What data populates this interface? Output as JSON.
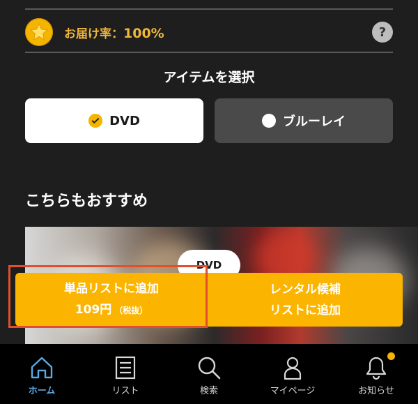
{
  "delivery": {
    "label": "お届け率：",
    "rate": "100%",
    "help_icon": "?",
    "badge_icon": "star-icon"
  },
  "item_select": {
    "title": "アイテムを選択",
    "options": [
      {
        "label": "DVD",
        "selected": true
      },
      {
        "label": "ブルーレイ",
        "selected": false
      }
    ]
  },
  "recommend": {
    "title": "こちらもおすすめ",
    "badge": "DVD"
  },
  "actions": {
    "single": {
      "line1": "単品リストに追加",
      "price": "109円",
      "tax": "（税抜）"
    },
    "rental": {
      "line1": "レンタル候補",
      "line2": "リストに追加"
    }
  },
  "nav": {
    "items": [
      {
        "label": "ホーム",
        "icon": "home-icon",
        "active": true
      },
      {
        "label": "リスト",
        "icon": "list-icon",
        "active": false
      },
      {
        "label": "検索",
        "icon": "search-icon",
        "active": false
      },
      {
        "label": "マイページ",
        "icon": "user-icon",
        "active": false
      },
      {
        "label": "お知らせ",
        "icon": "bell-icon",
        "active": false,
        "has_notification": true
      }
    ]
  },
  "colors": {
    "background": "#1e1e1e",
    "accent": "#fbb400",
    "active_nav": "#5aa9e6",
    "highlight": "#e0502a"
  }
}
